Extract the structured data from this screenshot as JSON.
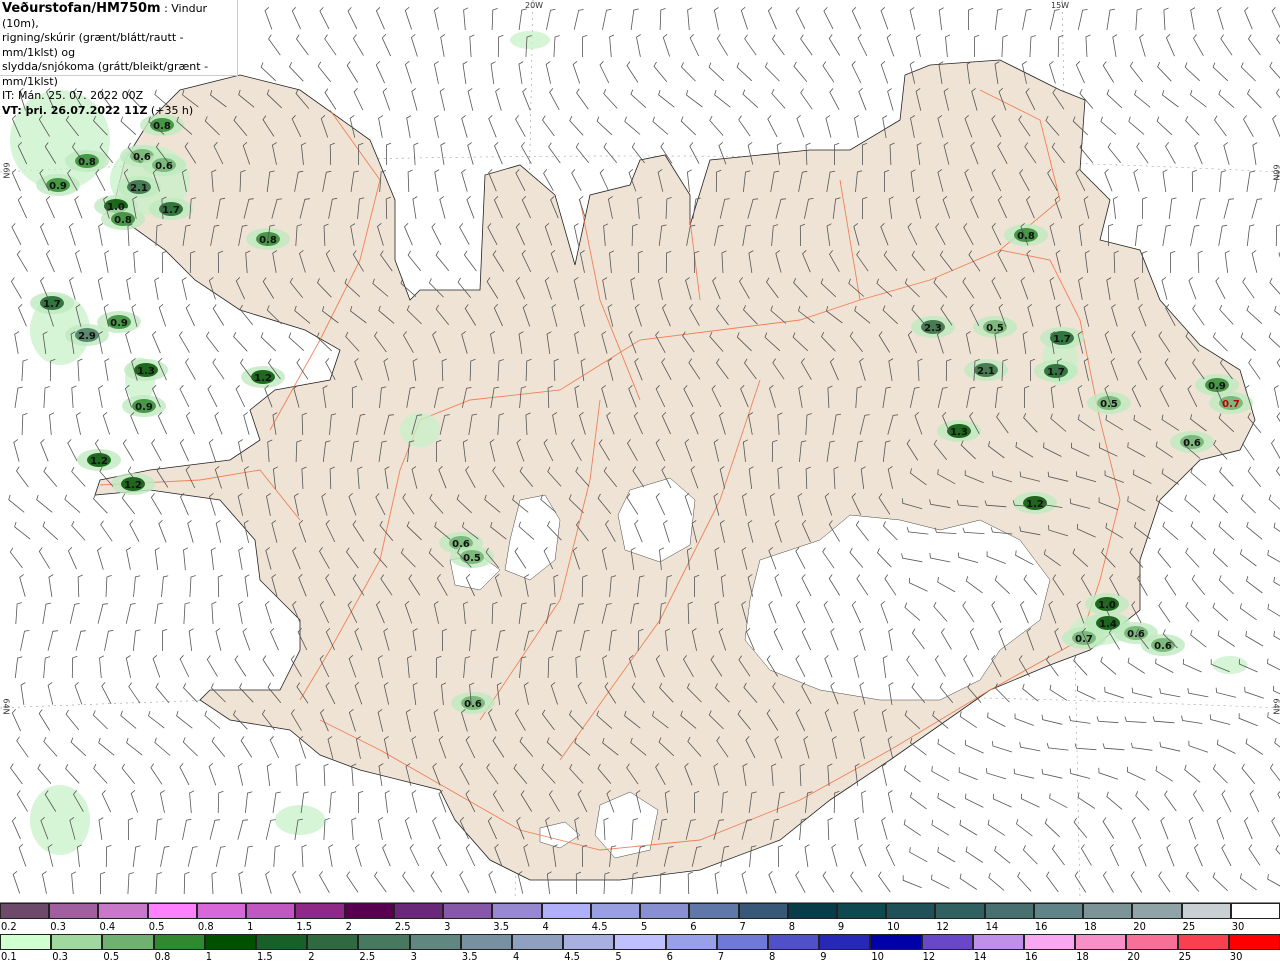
{
  "header": {
    "brand": "Veðurstofan/HM750m",
    "description_line1": " : Vindur (10m),",
    "description_line2": "rigning/skúrir (grænt/blátt/rautt - mm/1klst) og",
    "description_line3": "slydda/snjókoma (grátt/bleikt/grænt - mm/1klst)",
    "issue_time": "IT: Mán. 25. 07. 2022 00Z",
    "valid_label": "VT: þri. 26.07.2022 11Z",
    "valid_offset": " (+35 h)"
  },
  "grid_labels": {
    "lon_20w": "20W",
    "lon_15w": "15W",
    "lat_66n_left": "66N",
    "lat_64n_left": "64N",
    "lat_66n_right": "66N",
    "lat_64n_right": "64N"
  },
  "colors": {
    "land": "#efe3d5",
    "roads": "#f07040",
    "glacier": "#ffffff",
    "wind_barbs": "#555555",
    "sea": "#ffffff"
  },
  "precip_labels": [
    "0.8",
    "0.8",
    "0.6",
    "0.6",
    "0.9",
    "2.1",
    "1.0",
    "0.8",
    "1.7",
    "0.8",
    "1.7",
    "0.9",
    "2.9",
    "1.3",
    "0.9",
    "1.2",
    "1.2",
    "1.2",
    "0.6",
    "0.5",
    "0.6",
    "0.8",
    "2.3",
    "0.5",
    "1.7",
    "2.1",
    "1.7",
    "0.9",
    "0.7",
    "0.5",
    "1.3",
    "0.6",
    "1.2",
    "1.0",
    "1.4",
    "0.7",
    "0.6",
    "0.6"
  ],
  "legend_snow": {
    "labels": [
      "0.2",
      "0.3",
      "0.4",
      "0.5",
      "0.8",
      "1",
      "1.5",
      "2",
      "2.5",
      "3",
      "3.5",
      "4",
      "4.5",
      "5",
      "6",
      "7",
      "8",
      "9",
      "10",
      "12",
      "14",
      "16",
      "18",
      "20",
      "25",
      "30"
    ],
    "colors": [
      "#6e4a6a",
      "#a060a0",
      "#c878c8",
      "#ff80ff",
      "#d868d8",
      "#c058c0",
      "#902888",
      "#580050",
      "#6a2878",
      "#8858a8",
      "#9888d0",
      "#b0b0f8",
      "#98a0e0",
      "#8890d0",
      "#6078a8",
      "#385878",
      "#083c48",
      "#104850",
      "#205058",
      "#306060",
      "#487070",
      "#608488",
      "#7c9498",
      "#90a4a8",
      "#c8d0d4",
      "#ffffff"
    ]
  },
  "legend_rain": {
    "labels": [
      "0.1",
      "0.3",
      "0.5",
      "0.8",
      "1",
      "1.5",
      "2",
      "2.5",
      "3",
      "3.5",
      "4",
      "4.5",
      "5",
      "6",
      "7",
      "8",
      "9",
      "10",
      "12",
      "14",
      "16",
      "18",
      "20",
      "25",
      "30"
    ],
    "colors": [
      "#d0ffd0",
      "#a0d8a0",
      "#70b070",
      "#308830",
      "#005000",
      "#186028",
      "#306840",
      "#487860",
      "#608880",
      "#7890a0",
      "#90a0c0",
      "#a8b0e0",
      "#c0c0ff",
      "#98a0e8",
      "#7078d8",
      "#5050c8",
      "#2828b8",
      "#0000a8",
      "#6848c8",
      "#c090e8",
      "#f8a8f0",
      "#f890c8",
      "#f87098",
      "#f84050",
      "#ff0000"
    ]
  }
}
